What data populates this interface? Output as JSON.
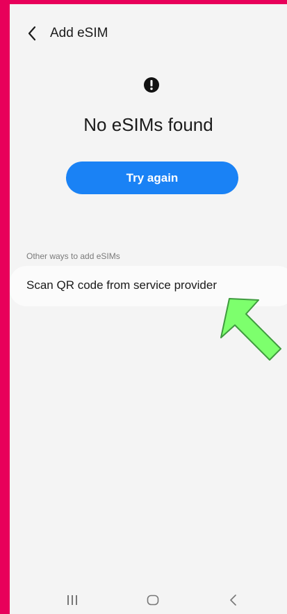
{
  "header": {
    "title": "Add eSIM"
  },
  "status": {
    "title": "No eSIMs found",
    "icon": "alert-icon"
  },
  "actions": {
    "try_again": "Try again"
  },
  "other_ways": {
    "label": "Other ways to add eSIMs",
    "items": [
      {
        "label": "Scan QR code from service provider"
      }
    ]
  },
  "colors": {
    "accent": "#1a82f5",
    "background": "#f4f4f4",
    "frame": "#e8005a",
    "annotation_arrow": "#7dff6d"
  }
}
